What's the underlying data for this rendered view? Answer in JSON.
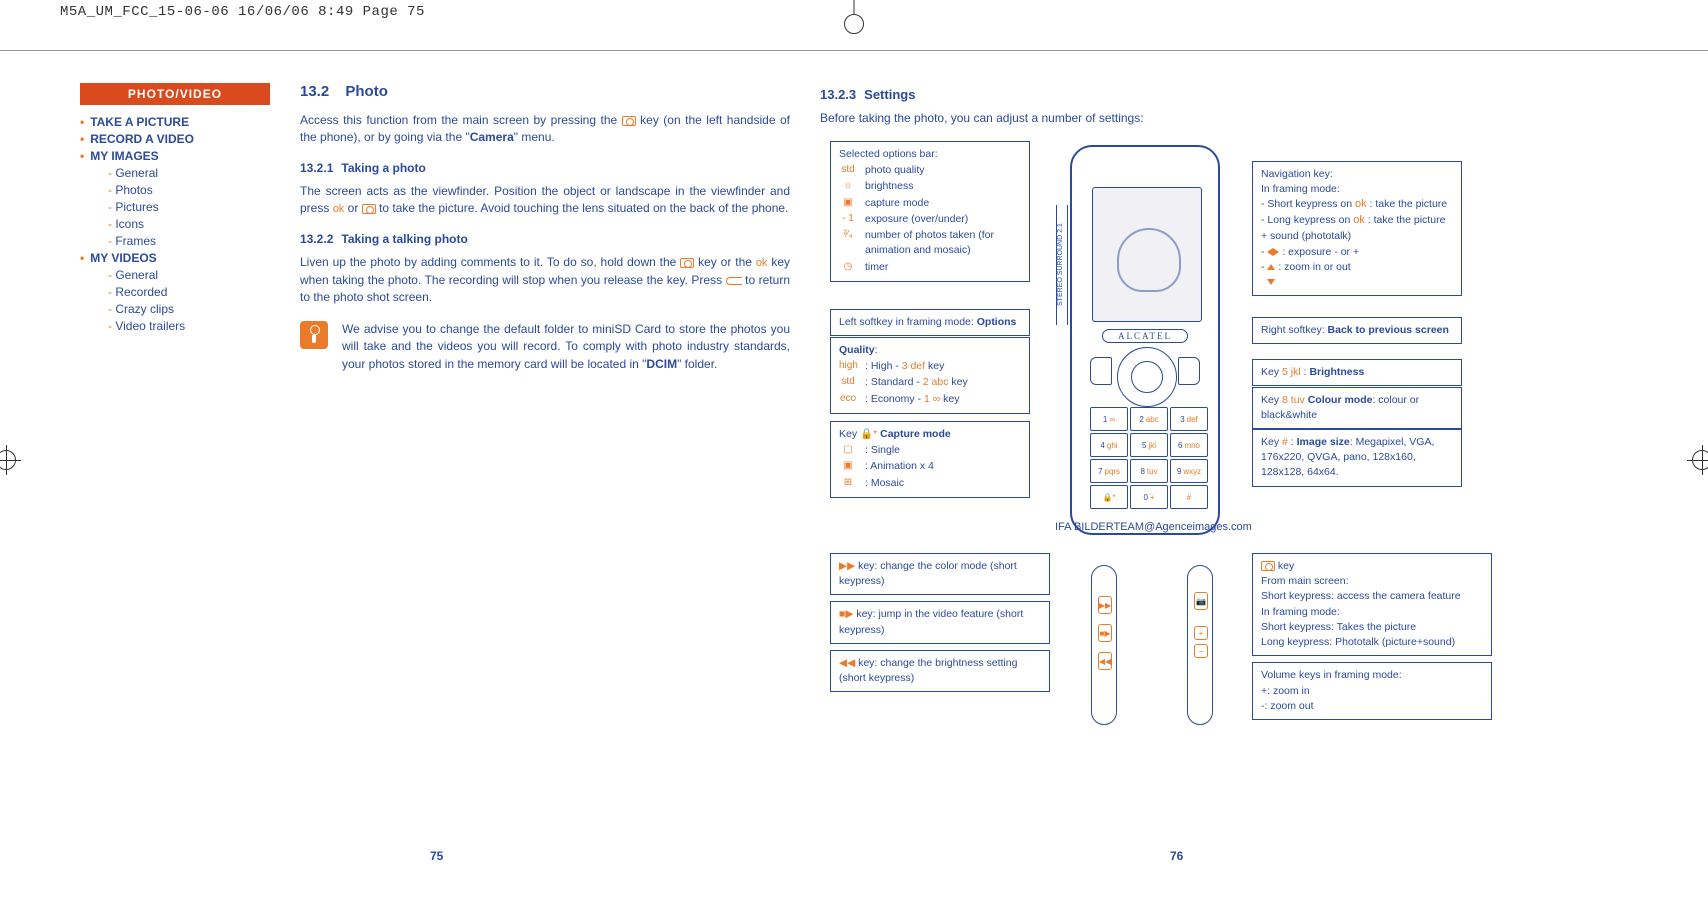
{
  "crop_header": "M5A_UM_FCC_15-06-06  16/06/06  8:49  Page 75",
  "sidebar": {
    "header": "PHOTO/VIDEO",
    "items": [
      {
        "label": "TAKE A PICTURE",
        "top": true
      },
      {
        "label": "RECORD A VIDEO",
        "top": true
      },
      {
        "label": "MY IMAGES",
        "top": true
      },
      {
        "label": "General",
        "top": false
      },
      {
        "label": "Photos",
        "top": false
      },
      {
        "label": "Pictures",
        "top": false
      },
      {
        "label": "Icons",
        "top": false
      },
      {
        "label": "Frames",
        "top": false
      },
      {
        "label": "MY VIDEOS",
        "top": true
      },
      {
        "label": "General",
        "top": false
      },
      {
        "label": "Recorded",
        "top": false
      },
      {
        "label": "Crazy clips",
        "top": false
      },
      {
        "label": "Video trailers",
        "top": false
      }
    ]
  },
  "left": {
    "h2_num": "13.2",
    "h2": "Photo",
    "p1_a": "Access this function from the main screen by pressing the ",
    "p1_b": " key (on the left handside of the phone), or by going via the \"",
    "p1_c": "Camera",
    "p1_d": "\" menu.",
    "h3a_num": "13.2.1",
    "h3a": "Taking a photo",
    "p2_a": "The screen acts as the viewfinder. Position the object or landscape in the viewfinder and press ",
    "p2_b": " or ",
    "p2_c": " to take the picture. Avoid touching the lens situated on the back of the phone.",
    "h3b_num": "13.2.2",
    "h3b": "Taking a talking photo",
    "p3_a": "Liven up the photo by adding comments to it. To do so, hold down the ",
    "p3_b": " key or the ",
    "p3_c": " key when taking the photo. The recording will stop when you release the key. Press ",
    "p3_d": " to return to the photo shot screen.",
    "tip_a": "We advise you to change the default folder to miniSD Card to store the photos you will take and the videos you will record. To comply with photo industry standards, your photos stored in the memory card will be located in \"",
    "tip_b": "DCIM",
    "tip_c": "\" folder.",
    "page_num": "75"
  },
  "right": {
    "h3_num": "13.2.3",
    "h3": "Settings",
    "intro": "Before taking the photo, you can adjust a number of settings:",
    "selected_bar": {
      "title": "Selected options bar:",
      "rows": [
        {
          "icon": "std",
          "text": "photo quality"
        },
        {
          "icon": "☼",
          "text": "brightness"
        },
        {
          "icon": "▣",
          "text": "capture mode"
        },
        {
          "icon": "- 1",
          "text": "exposure (over/under)"
        },
        {
          "icon": "²⁄₄",
          "text": "number of photos taken (for animation and mosaic)"
        },
        {
          "icon": "◷",
          "text": "timer"
        }
      ]
    },
    "left_softkey": {
      "prefix": "Left softkey in framing mode: ",
      "bold": "Options"
    },
    "quality": {
      "title": "Quality",
      "rows": [
        {
          "icon": "high",
          "sep": " : High - ",
          "key": "3 def",
          "suffix": " key"
        },
        {
          "icon": "std",
          "sep": " : Standard - ",
          "key": "2 abc",
          "suffix": " key"
        },
        {
          "icon": "eco",
          "sep": " : Economy - ",
          "key": "1 ∞",
          "suffix": " key"
        }
      ]
    },
    "capture": {
      "prefix": "Key ",
      "key_icon": "🔒*",
      "bold": "Capture mode",
      "rows": [
        {
          "icon": "▢",
          "text": ": Single"
        },
        {
          "icon": "▣",
          "text": ": Animation x 4"
        },
        {
          "icon": "⊞",
          "text": ": Mosaic"
        }
      ]
    },
    "nav": {
      "title": "Navigation key:",
      "line0": "In framing mode:",
      "line1": "Short keypress on ",
      "line1b": " : take the picture",
      "line2": "Long keypress on ",
      "line2b": " : take the picture + sound (phototalk)",
      "line3": " : exposure - or +",
      "line4": " : zoom in or out"
    },
    "right_softkey": {
      "prefix": "Right softkey: ",
      "bold": "Back to previous screen"
    },
    "key5": {
      "prefix": "Key ",
      "key": "5 jkl",
      "sep": " : ",
      "bold": "Brightness"
    },
    "key8": {
      "prefix": "Key ",
      "key": "8 tuv",
      "sep": " ",
      "bold": "Colour mode",
      "rest": ": colour or black&white"
    },
    "keyhash": {
      "prefix": "Key ",
      "key": "#",
      "sep": " : ",
      "bold": "Image size",
      "rest": ": Megapixel, VGA, 176x220, QVGA, pano, 128x160, 128x128, 64x64."
    },
    "phone": {
      "brand": "ALCATEL",
      "side_label": "STEREO SURROUND 2.1",
      "keys": [
        "1 ∞",
        "2 abc",
        "3 def",
        "4 ghi",
        "5 jkl",
        "6 mno",
        "7 pqrs",
        "8 tuv",
        "9 wxyz",
        "🔒*",
        "0 +",
        "#"
      ]
    },
    "credit": "IFA BILDERTEAM@Agenceimages.com",
    "lower_left": [
      {
        "icon": "▶▶",
        "text": " key: change the color mode (short keypress)"
      },
      {
        "icon": "■▶",
        "text": " key: jump in the video feature (short keypress)"
      },
      {
        "icon": "◀◀",
        "text": " key: change the brightness setting (short keypress)"
      }
    ],
    "lower_right": {
      "camkey": {
        "icon_label": "key",
        "lines": [
          "From main screen:",
          "Short keypress: access the camera feature",
          "In framing mode:",
          "Short keypress: Takes the picture",
          "Long keypress: Phototalk (picture+sound)"
        ]
      },
      "volume": {
        "title": "Volume keys in framing mode:",
        "plus": "+: zoom in",
        "minus": "-: zoom out"
      }
    },
    "page_num": "76"
  }
}
